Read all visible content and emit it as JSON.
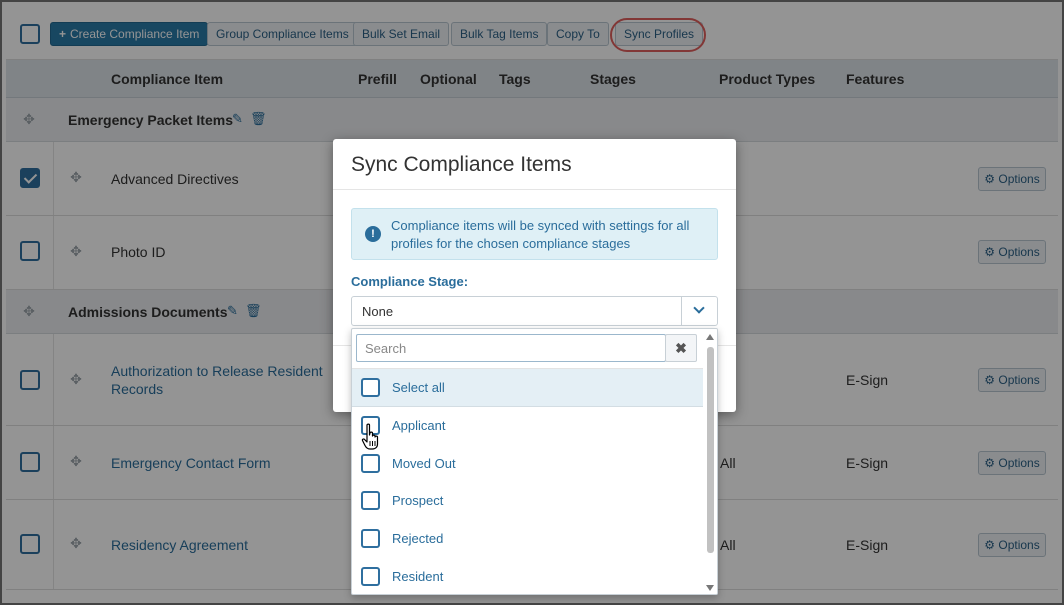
{
  "toolbar": {
    "create": "Create Compliance Item",
    "group": "Group Compliance Items",
    "bulk_email": "Bulk Set Email",
    "bulk_tag": "Bulk Tag Items",
    "copy_to": "Copy To",
    "sync_profiles": "Sync Profiles"
  },
  "table": {
    "headers": {
      "item": "Compliance Item",
      "prefill": "Prefill",
      "optional": "Optional",
      "tags": "Tags",
      "stages": "Stages",
      "product_types": "Product Types",
      "features": "Features"
    },
    "groups": [
      {
        "title": "Emergency Packet Items",
        "items": [
          {
            "name": "Advanced Directives",
            "checked": true,
            "product_type": "",
            "feature": "",
            "options": "Options"
          },
          {
            "name": "Photo ID",
            "checked": false,
            "product_type": "",
            "feature": "",
            "options": "Options"
          }
        ]
      },
      {
        "title": "Admissions Documents",
        "items": [
          {
            "name": "Authorization to Release Resident",
            "name2": "Records",
            "checked": false,
            "product_type": "",
            "feature": "E-Sign",
            "options": "Options"
          },
          {
            "name": "Emergency Contact Form",
            "checked": false,
            "product_type": "All",
            "feature": "E-Sign",
            "options": "Options"
          },
          {
            "name": "Residency Agreement",
            "checked": false,
            "product_type": "All",
            "feature": "E-Sign",
            "options": "Options"
          }
        ]
      }
    ]
  },
  "modal": {
    "title": "Sync Compliance Items",
    "info": "Compliance items will be synced with settings for all profiles for the chosen compliance stages",
    "stage_label": "Compliance Stage:",
    "stage_value": "None"
  },
  "dropdown": {
    "search_placeholder": "Search",
    "clear_label": "✖",
    "items": [
      "Select all",
      "Applicant",
      "Moved Out",
      "Prospect",
      "Rejected",
      "Resident"
    ]
  },
  "colors": {
    "accent": "#2a7aa8",
    "link": "#2a6d9b",
    "highlight_ring": "#e0605e"
  }
}
